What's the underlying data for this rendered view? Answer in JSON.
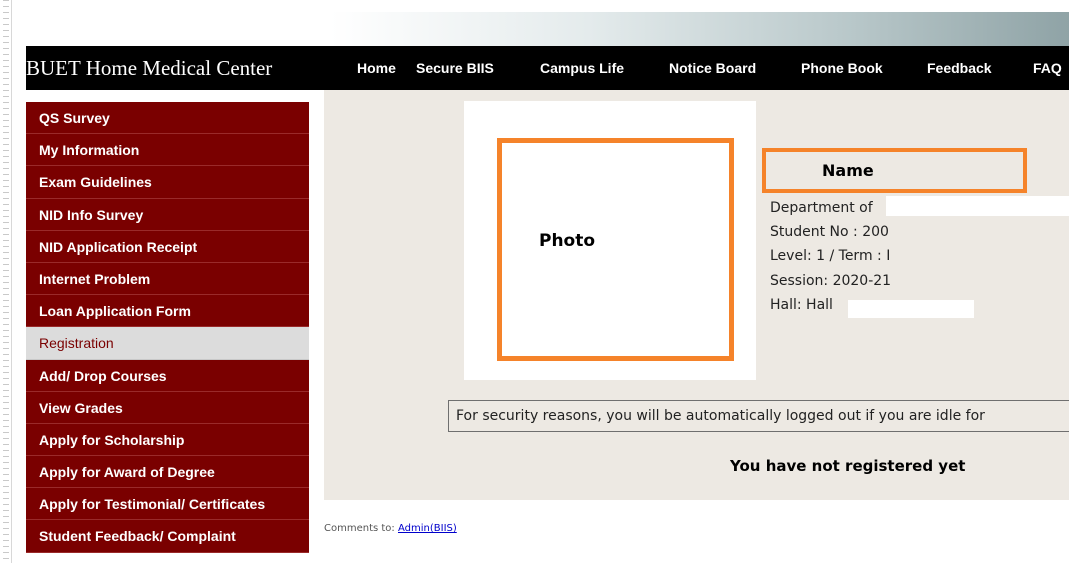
{
  "header": {
    "brand": "BUET Home  Medical Center",
    "nav": [
      "Home",
      "Secure BIIS",
      "Campus Life",
      "Notice Board",
      "Phone Book",
      "Feedback",
      "FAQ"
    ]
  },
  "sidebar": {
    "items": [
      {
        "label": "QS Survey"
      },
      {
        "label": "My Information"
      },
      {
        "label": "Exam Guidelines"
      },
      {
        "label": "NID Info Survey"
      },
      {
        "label": "NID Application Receipt"
      },
      {
        "label": "Internet Problem"
      },
      {
        "label": "Loan Application Form"
      },
      {
        "label": "Registration"
      },
      {
        "label": "Add/ Drop Courses"
      },
      {
        "label": "View Grades"
      },
      {
        "label": "Apply for Scholarship"
      },
      {
        "label": "Apply for Award of Degree"
      },
      {
        "label": "Apply for Testimonial/ Certificates"
      },
      {
        "label": "Student Feedback/ Complaint"
      }
    ],
    "active_index": 7
  },
  "profile": {
    "photo_label": "Photo",
    "name_label": "Name",
    "department": "Department of",
    "student_no": "Student No : 200",
    "level_term": "Level: 1 / Term : I",
    "session": "Session: 2020-21",
    "hall": "Hall: Hall"
  },
  "main": {
    "notice": "For security reasons, you will be automatically logged out if you are idle for",
    "status": "You have not registered yet"
  },
  "footer": {
    "prefix": "Comments to: ",
    "link": "Admin(BIIS)"
  },
  "colors": {
    "sidebar_bg": "#7a0000",
    "highlight_border": "#f5832a",
    "content_bg": "#ede9e3",
    "navbar_bg": "#000000"
  }
}
